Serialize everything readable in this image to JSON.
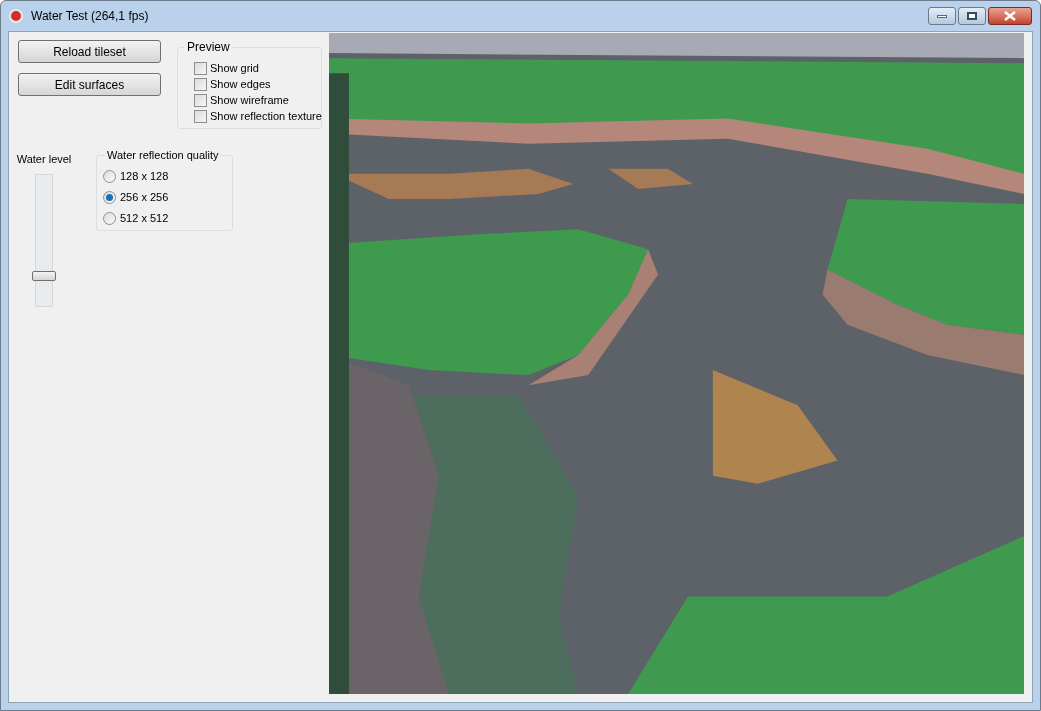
{
  "window": {
    "title": "Water Test (264,1 fps)"
  },
  "buttons": [
    {
      "label": "Reload tileset"
    },
    {
      "label": "Edit surfaces"
    }
  ],
  "preview": {
    "title": "Preview",
    "options": [
      {
        "label": "Show grid",
        "checked": false
      },
      {
        "label": "Show edges",
        "checked": false
      },
      {
        "label": "Show wireframe",
        "checked": false
      },
      {
        "label": "Show reflection texture",
        "checked": false
      }
    ]
  },
  "water_level": {
    "label": "Water level",
    "level": 0.2
  },
  "reflection_quality": {
    "title": "Water reflection quality",
    "options": [
      {
        "label": "128 x 128",
        "selected": false
      },
      {
        "label": "256 x 256",
        "selected": true
      },
      {
        "label": "512 x 512",
        "selected": false
      }
    ]
  }
}
